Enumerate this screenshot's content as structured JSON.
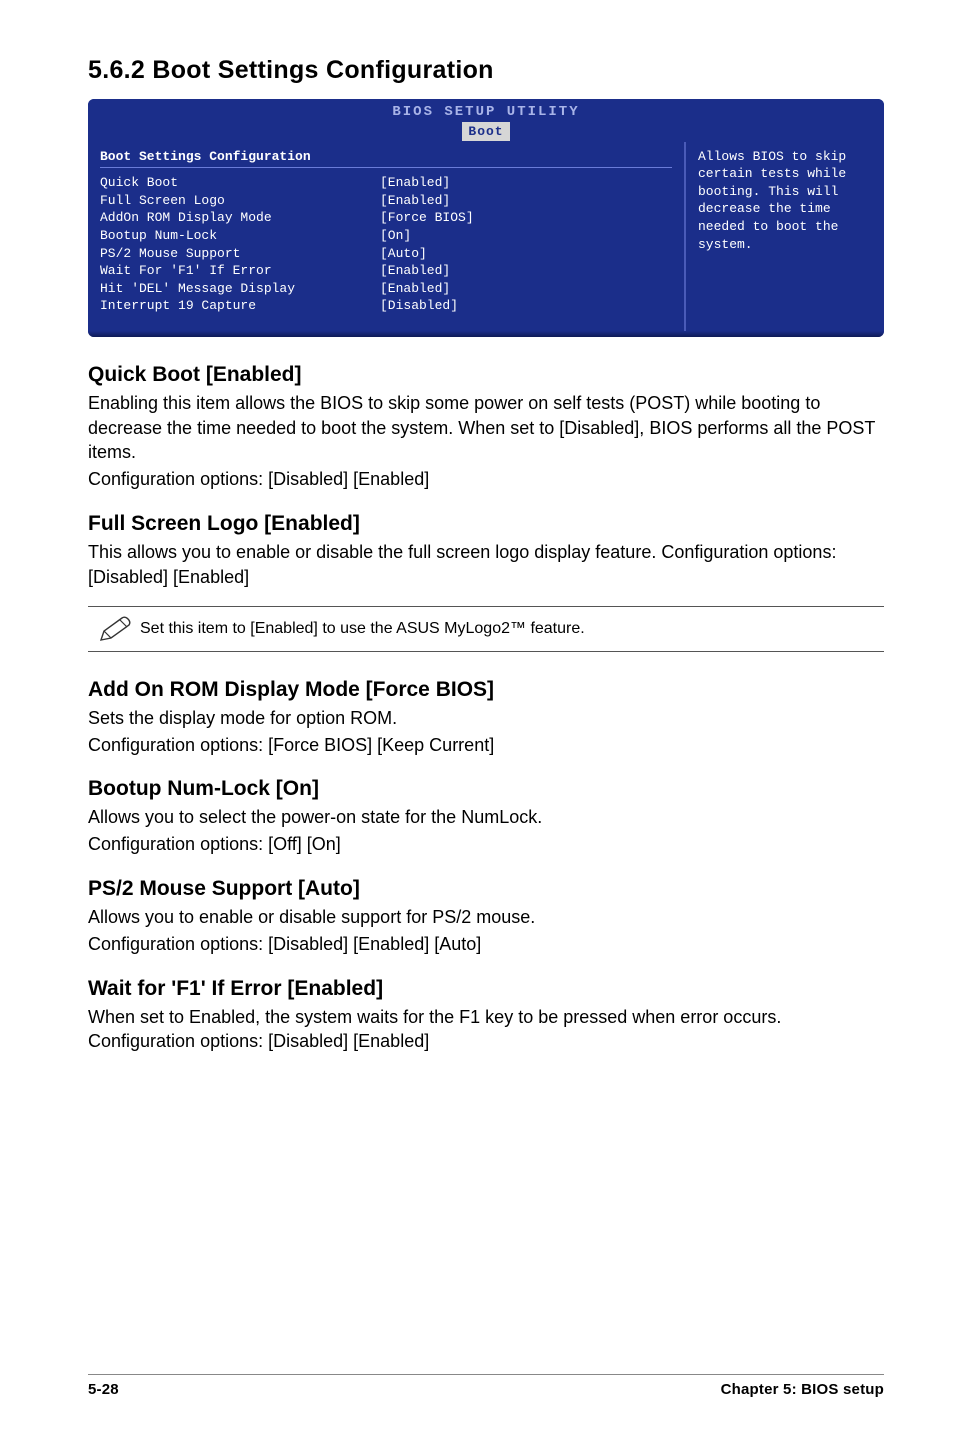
{
  "heading": "5.6.2   Boot Settings Configuration",
  "bios": {
    "header_title": "BIOS SETUP UTILITY",
    "tab": "Boot",
    "section_title": "Boot Settings Configuration",
    "rows": [
      {
        "label": "Quick Boot",
        "value": "[Enabled]"
      },
      {
        "label": "Full Screen Logo",
        "value": "[Enabled]"
      },
      {
        "label": "AddOn ROM Display Mode",
        "value": "[Force BIOS]"
      },
      {
        "label": "Bootup Num-Lock",
        "value": "[On]"
      },
      {
        "label": "PS/2 Mouse Support",
        "value": "[Auto]"
      },
      {
        "label": "Wait For 'F1' If Error",
        "value": "[Enabled]"
      },
      {
        "label": "Hit 'DEL' Message Display",
        "value": "[Enabled]"
      },
      {
        "label": "Interrupt 19 Capture",
        "value": "[Disabled]"
      }
    ],
    "help_text": "Allows BIOS to skip certain tests while booting. This will decrease the time needed to boot the system."
  },
  "sections": {
    "quick_boot": {
      "title": "Quick Boot [Enabled]",
      "para": "Enabling this item allows the BIOS to skip some power on self tests (POST) while booting to decrease the time needed to boot the system. When set to [Disabled], BIOS performs all the POST items.",
      "config": "Configuration options: [Disabled] [Enabled]"
    },
    "full_screen": {
      "title": "Full Screen Logo [Enabled]",
      "para": "This allows you to enable or disable the full screen logo display feature. Configuration options: [Disabled] [Enabled]"
    },
    "note": "Set this item to [Enabled] to use the ASUS MyLogo2™ feature.",
    "addon_rom": {
      "title": "Add On ROM Display Mode [Force BIOS]",
      "para": "Sets the display mode for option ROM.",
      "config": "Configuration options: [Force BIOS] [Keep Current]"
    },
    "numlock": {
      "title": "Bootup Num-Lock [On]",
      "para": "Allows you to select the power-on state for the NumLock.",
      "config": "Configuration options: [Off] [On]"
    },
    "ps2": {
      "title": "PS/2 Mouse Support [Auto]",
      "para": "Allows you to enable or disable support for PS/2 mouse.",
      "config": "Configuration options: [Disabled] [Enabled] [Auto]"
    },
    "f1": {
      "title": "Wait for 'F1' If Error [Enabled]",
      "para": "When set to Enabled, the system waits for the F1 key to be pressed when error occurs. Configuration options: [Disabled] [Enabled]"
    }
  },
  "footer": {
    "left": "5-28",
    "right": "Chapter 5: BIOS setup"
  }
}
